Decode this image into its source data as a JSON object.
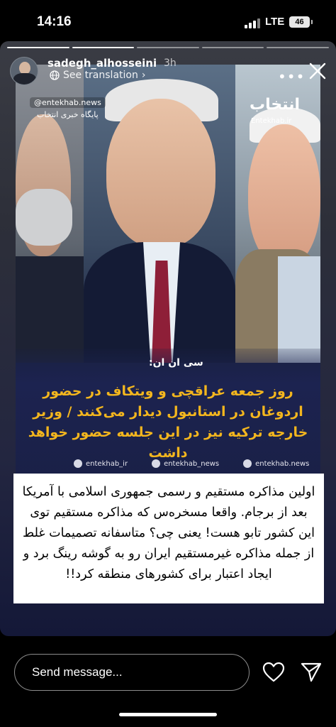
{
  "status_bar": {
    "time": "14:16",
    "network": "LTE",
    "battery": "46"
  },
  "story": {
    "progress_segments": 5,
    "progress_done": 2,
    "username": "sadegh_alhosseini",
    "time_ago": "3h",
    "see_translation": "See translation",
    "more_icon": "more-horizontal-icon",
    "close_icon": "close-icon"
  },
  "news_image": {
    "watermark_left": "@entekhab.news",
    "watermark_left_sub": "پایگاه خبری انتخاب",
    "logo_right": "انتخاب",
    "logo_right_sub": "Entekhab.ir",
    "source_tag": "سی ان ان:",
    "headline": "روز جمعه عراقچی و ویتکاف در حضور اردوغان در استانبول دیدار می‌کنند / وزیر خارجه ترکیه نیز در این جلسه حضور خواهد داشت",
    "social": [
      "entekhab_ir",
      "entekhab_news",
      "entekhab.news"
    ]
  },
  "caption": "اولین مذاکره مستقیم و رسمی جمهوری اسلامی با آمریکا بعد از برجام. واقعا مسخره‌س که مذاکره مستقیم توی این کشور تابو هست! یعنی چی؟ متاسفانه تصمیمات غلط از جمله مذاکره غیرمستقیم ایران رو به گوشه رینگ برد و ایجاد اعتبار برای کشورهای منطقه کرد!!",
  "bottom_bar": {
    "message_placeholder": "Send message...",
    "heart_icon": "heart-icon",
    "send_icon": "send-icon"
  }
}
